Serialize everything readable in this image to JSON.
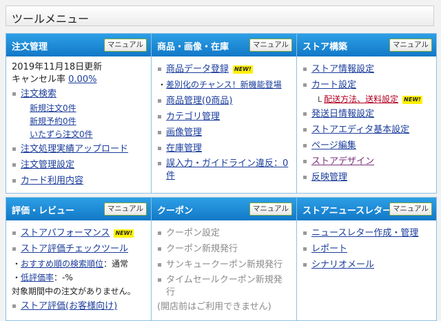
{
  "page_title": "ツールメニュー",
  "manual_label": "マニュアル",
  "new_badge": "NEW!",
  "orders": {
    "title": "注文管理",
    "updated": "2019年11月18日更新",
    "cancel_rate_label": "キャンセル率",
    "cancel_rate_value": "0.00%",
    "search": "注文検索",
    "new_orders": "新規注文0件",
    "new_reservations": "新規予約0件",
    "prank_orders": "いたずら注文0件",
    "upload": "注文処理実績アップロード",
    "settings": "注文管理設定",
    "card_usage": "カード利用内容"
  },
  "products": {
    "title": "商品・画像・在庫",
    "register": "商品データ登録",
    "chance": "差別化のチャンス！新機能登場",
    "manage": "商品管理(0商品)",
    "category": "カテゴリ管理",
    "image": "画像管理",
    "stock": "在庫管理",
    "violation": "誤入力・ガイドライン違反：0件"
  },
  "store": {
    "title": "ストア構築",
    "info": "ストア情報設定",
    "cart": "カート設定",
    "cart_prefix": "L",
    "shipping": "配送方法、送料設定",
    "ship_date": "発送日情報設定",
    "editor": "ストアエディタ基本設定",
    "page_edit": "ページ編集",
    "design": "ストアデザイン",
    "reflect": "反映管理"
  },
  "review": {
    "title": "評価・レビュー",
    "performance": "ストアパフォーマンス",
    "check_tool": "ストア評価チェックツール",
    "recommend_label": "おすすめ順の検索順位",
    "recommend_value": "：通常",
    "low_rate_label": "低評価率",
    "low_rate_value": "：-%",
    "no_orders": "対象期間中の注文がありません。",
    "customer": "ストア評価(お客様向け)"
  },
  "coupon": {
    "title": "クーポン",
    "settings": "クーポン設定",
    "new": "クーポン新規発行",
    "thankyou": "サンキュークーポン新規発行",
    "timesale": "タイムセールクーポン新規発行",
    "note": "(開店前はご利用できません)"
  },
  "newsletter": {
    "title": "ストアニュースレター",
    "create": "ニュースレター作成・管理",
    "report": "レポート",
    "scenario": "シナリオメール"
  }
}
